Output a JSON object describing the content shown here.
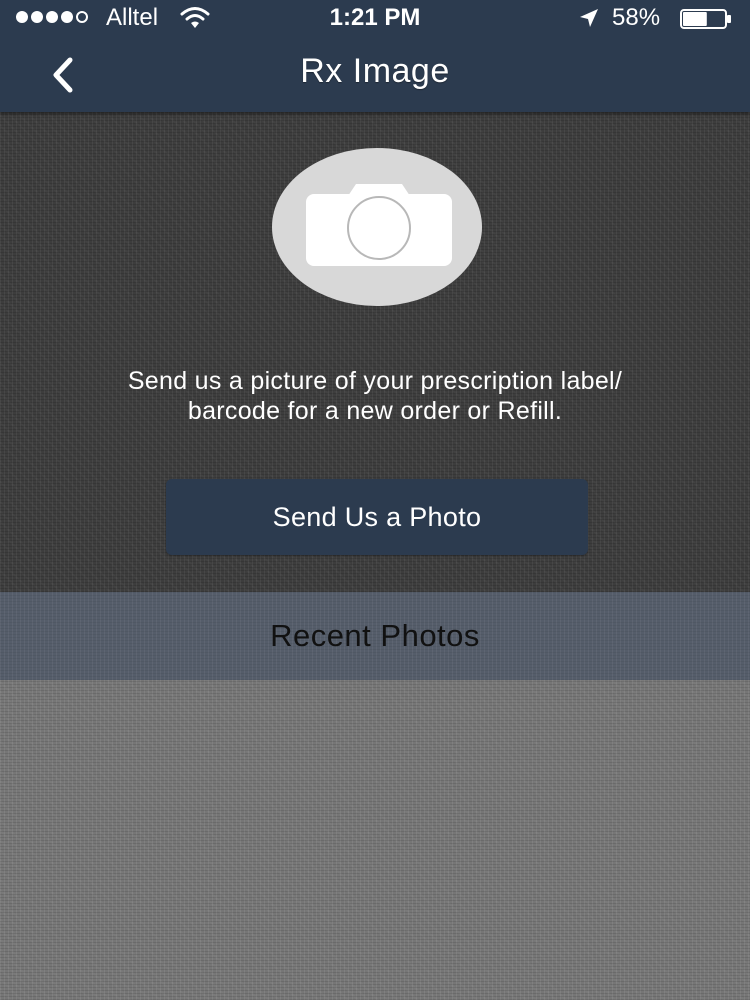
{
  "status_bar": {
    "carrier": "Alltel",
    "time": "1:21 PM",
    "battery_percent": "58%",
    "battery_level": 0.58,
    "signal_bars_filled": 4,
    "signal_bars_total": 5,
    "icons": [
      "signal-dots",
      "wifi-icon",
      "location-arrow-icon",
      "battery-icon"
    ]
  },
  "nav": {
    "title": "Rx Image",
    "back_icon": "chevron-left-icon"
  },
  "main": {
    "camera_icon": "camera-icon",
    "instruction_line1": "Send us a picture of your prescription label/",
    "instruction_line2": "barcode for a new order or Refill.",
    "send_button_label": "Send Us a Photo"
  },
  "recent": {
    "title": "Recent Photos"
  },
  "colors": {
    "nav_background": "#2c3b4f",
    "button_background": "#2c3b4f",
    "camera_circle": "#d8d8d8",
    "recent_band": "#555d6a"
  }
}
